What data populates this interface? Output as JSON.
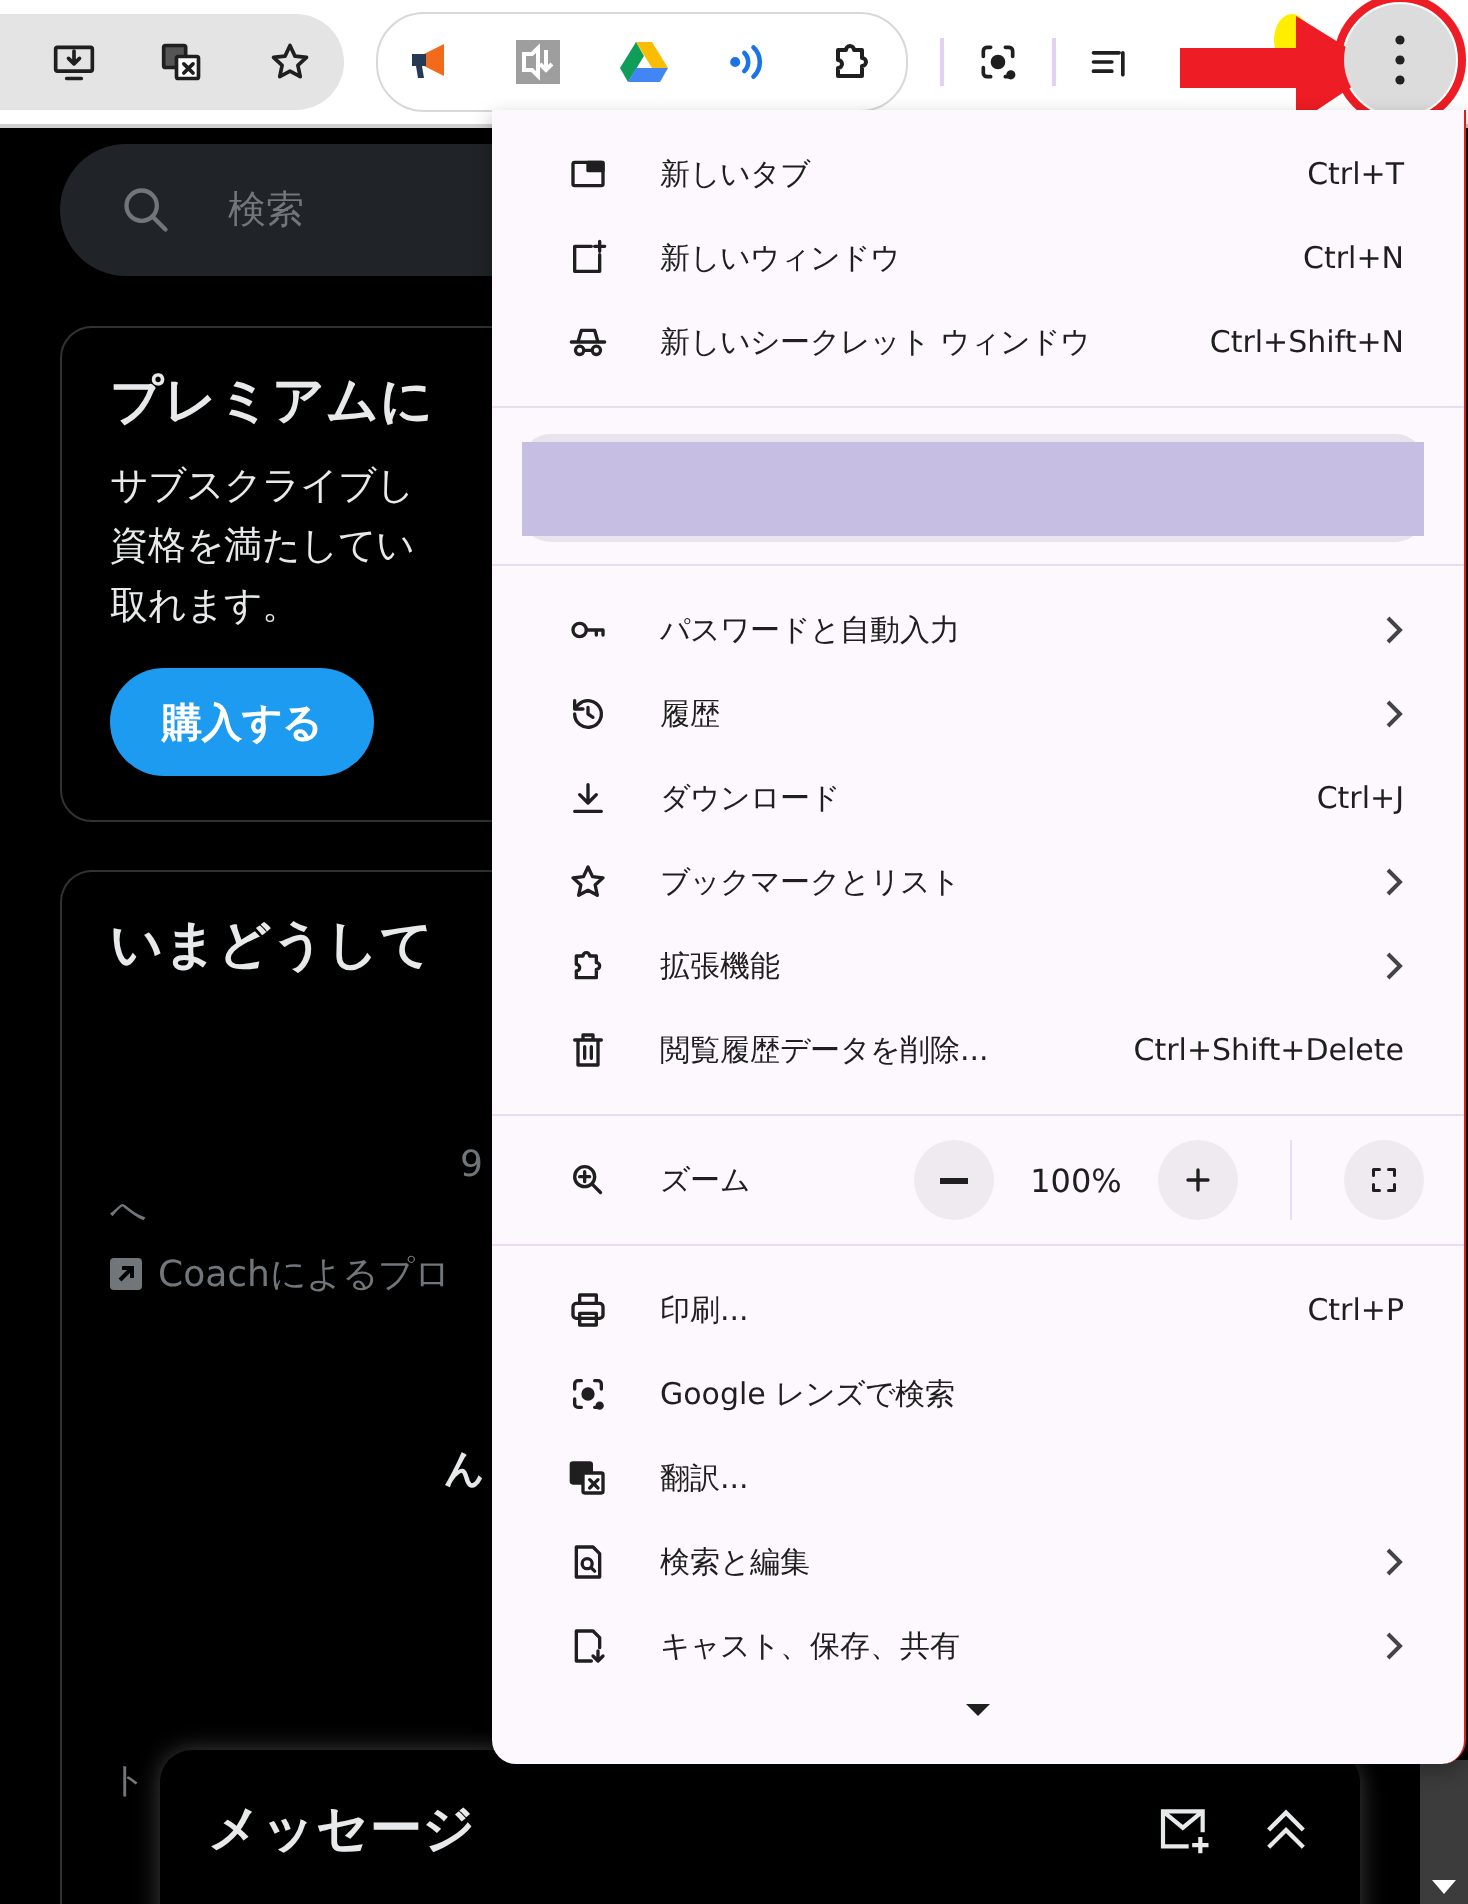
{
  "page": {
    "search": {
      "placeholder": "検索"
    },
    "premium_card": {
      "title": "プレミアムに",
      "body_lines": [
        "サブスクライブし",
        "資格を満たしてい",
        "取れます。"
      ],
      "button": "購入する"
    },
    "trends_card": {
      "title": "いまどうして",
      "count": "9",
      "line": "へ",
      "promo": "Coachによるプロ",
      "name_fragment": "ん",
      "bottom_fragment": "ト"
    }
  },
  "messages": {
    "title": "メッセージ"
  },
  "menu": {
    "sections": [
      {
        "kind": "items",
        "items": [
          {
            "label": "新しいタブ",
            "shortcut": "Ctrl+T",
            "submenu": false
          },
          {
            "label": "新しいウィンドウ",
            "shortcut": "Ctrl+N",
            "submenu": false
          },
          {
            "label": "新しいシークレット ウィンドウ",
            "shortcut": "Ctrl+Shift+N",
            "submenu": false
          }
        ]
      },
      {
        "kind": "profile"
      },
      {
        "kind": "items",
        "items": [
          {
            "label": "パスワードと自動入力",
            "submenu": true
          },
          {
            "label": "履歴",
            "submenu": true
          },
          {
            "label": "ダウンロード",
            "shortcut": "Ctrl+J",
            "submenu": false
          },
          {
            "label": "ブックマークとリスト",
            "submenu": true
          },
          {
            "label": "拡張機能",
            "submenu": true
          },
          {
            "label": "閲覧履歴データを削除...",
            "shortcut": "Ctrl+Shift+Delete",
            "submenu": false
          }
        ]
      },
      {
        "kind": "zoom",
        "label": "ズーム",
        "value": "100%"
      },
      {
        "kind": "items",
        "items": [
          {
            "label": "印刷...",
            "shortcut": "Ctrl+P",
            "submenu": false
          },
          {
            "label": "Google レンズで検索",
            "submenu": false
          },
          {
            "label": "翻訳...",
            "submenu": false
          },
          {
            "label": "検索と編集",
            "submenu": true
          },
          {
            "label": "キャスト、保存、共有",
            "submenu": true
          }
        ]
      }
    ]
  }
}
